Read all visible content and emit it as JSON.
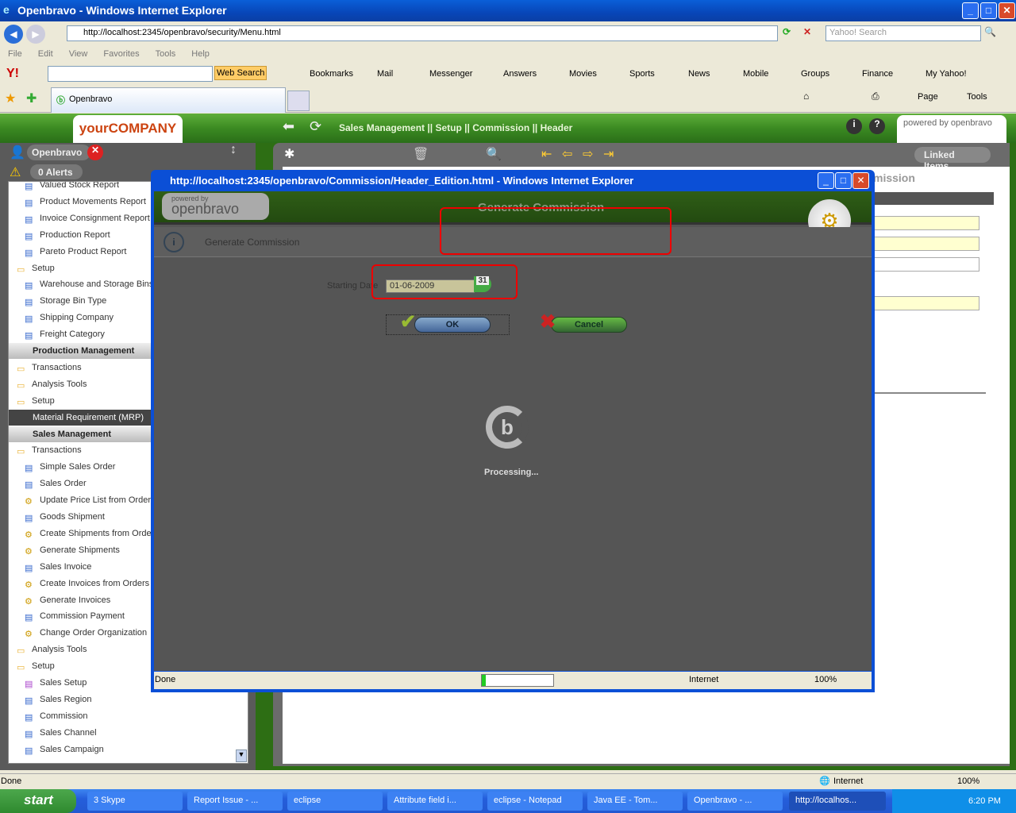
{
  "window": {
    "title": "Openbravo - Windows Internet Explorer",
    "url": "http://localhost:2345/openbravo/security/Menu.html",
    "search_placeholder": "Yahoo! Search"
  },
  "menu": [
    "File",
    "Edit",
    "View",
    "Favorites",
    "Tools",
    "Help"
  ],
  "yahoo": {
    "web_search": "Web Search",
    "items": [
      "Bookmarks",
      "Mail",
      "Messenger",
      "Answers",
      "Movies",
      "Sports",
      "News",
      "Mobile",
      "Groups",
      "Finance",
      "My Yahoo!"
    ]
  },
  "tab": {
    "label": "Openbravo"
  },
  "cmd": {
    "page": "Page",
    "tools": "Tools"
  },
  "app": {
    "logo": "yourCOMPANY",
    "breadcrumb": [
      "Sales Management",
      "Setup",
      "Commission",
      "Header"
    ],
    "sep": "||",
    "powered": "powered by openbravo",
    "user": "Openbravo",
    "alerts": "0 Alerts",
    "linked_items": "Linked Items",
    "tab_partial": "mission"
  },
  "tree": [
    {
      "t": "r",
      "l": "Valued Stock Report"
    },
    {
      "t": "r",
      "l": "Product Movements Report"
    },
    {
      "t": "r",
      "l": "Invoice Consignment Report"
    },
    {
      "t": "r",
      "l": "Production Report"
    },
    {
      "t": "r",
      "l": "Pareto Product Report"
    },
    {
      "t": "f",
      "l": "Setup"
    },
    {
      "t": "r",
      "l": "Warehouse and Storage Bins"
    },
    {
      "t": "r",
      "l": "Storage Bin Type"
    },
    {
      "t": "r",
      "l": "Shipping Company"
    },
    {
      "t": "r",
      "l": "Freight Category"
    },
    {
      "t": "h",
      "l": "Production Management"
    },
    {
      "t": "f",
      "l": "Transactions"
    },
    {
      "t": "f",
      "l": "Analysis Tools"
    },
    {
      "t": "f",
      "l": "Setup"
    },
    {
      "t": "hd",
      "l": "Material Requirement (MRP)"
    },
    {
      "t": "h",
      "l": "Sales Management"
    },
    {
      "t": "f",
      "l": "Transactions"
    },
    {
      "t": "r",
      "l": "Simple Sales Order"
    },
    {
      "t": "r",
      "l": "Sales Order"
    },
    {
      "t": "g",
      "l": "Update Price List from Orders"
    },
    {
      "t": "r",
      "l": "Goods Shipment"
    },
    {
      "t": "g",
      "l": "Create Shipments from Orders"
    },
    {
      "t": "g",
      "l": "Generate Shipments"
    },
    {
      "t": "r",
      "l": "Sales Invoice"
    },
    {
      "t": "g",
      "l": "Create Invoices from Orders"
    },
    {
      "t": "g",
      "l": "Generate Invoices"
    },
    {
      "t": "r",
      "l": "Commission Payment"
    },
    {
      "t": "g",
      "l": "Change Order Organization"
    },
    {
      "t": "f",
      "l": "Analysis Tools"
    },
    {
      "t": "f",
      "l": "Setup"
    },
    {
      "t": "s",
      "l": "Sales Setup"
    },
    {
      "t": "r",
      "l": "Sales Region"
    },
    {
      "t": "r",
      "l": "Commission"
    },
    {
      "t": "r",
      "l": "Sales Channel"
    },
    {
      "t": "r",
      "l": "Sales Campaign"
    }
  ],
  "popup": {
    "title": "http://localhost:2345/openbravo/Commission/Header_Edition.html - Windows Internet Explorer",
    "powered": "powered by",
    "logo": "openbravo",
    "heading": "Generate Commission",
    "info": "Generate Commission",
    "field_label": "Starting Date",
    "field_value": "01-06-2009",
    "calendar": "31",
    "ok": "OK",
    "cancel": "Cancel",
    "processing": "Processing...",
    "status": "Done",
    "zone": "Internet",
    "zoom": "100%"
  },
  "status": {
    "text": "Done",
    "zone": "Internet",
    "zoom": "100%"
  },
  "taskbar": {
    "start": "start",
    "tasks": [
      "3 Skype",
      "Report Issue - ...",
      "eclipse",
      "Attribute field i...",
      "eclipse - Notepad",
      "Java EE - Tom...",
      "Openbravo - ...",
      "http://localhos..."
    ],
    "clock": "6:20 PM"
  }
}
